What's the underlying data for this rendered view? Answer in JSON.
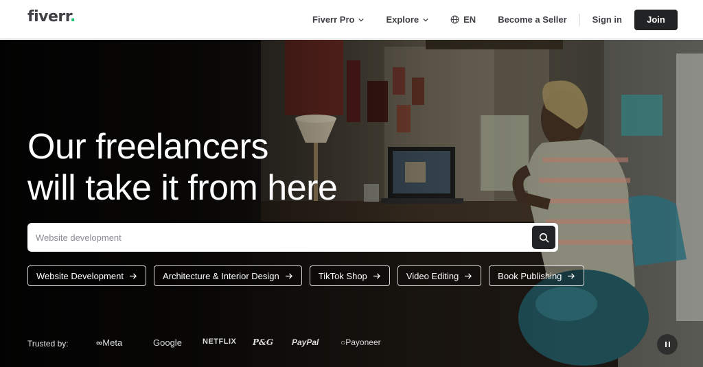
{
  "header": {
    "logo_text": "fiverr",
    "logo_dot": ".",
    "nav": {
      "fiverr_pro": "Fiverr Pro",
      "explore": "Explore",
      "language": "EN",
      "become_seller": "Become a Seller",
      "sign_in": "Sign in",
      "join": "Join"
    }
  },
  "hero": {
    "headline_line1": "Our freelancers",
    "headline_line2": "will take it from here",
    "search": {
      "placeholder": "Website development"
    },
    "chips": [
      "Website Development",
      "Architecture & Interior Design",
      "TikTok Shop",
      "Video Editing",
      "Book Publishing"
    ],
    "trusted_label": "Trusted by:",
    "brands": [
      "Meta",
      "Google",
      "NETFLIX",
      "P&G",
      "PayPal",
      "Payoneer"
    ]
  },
  "colors": {
    "brand_green": "#1dbf73",
    "dark_button": "#222325",
    "text_dark": "#404145"
  }
}
